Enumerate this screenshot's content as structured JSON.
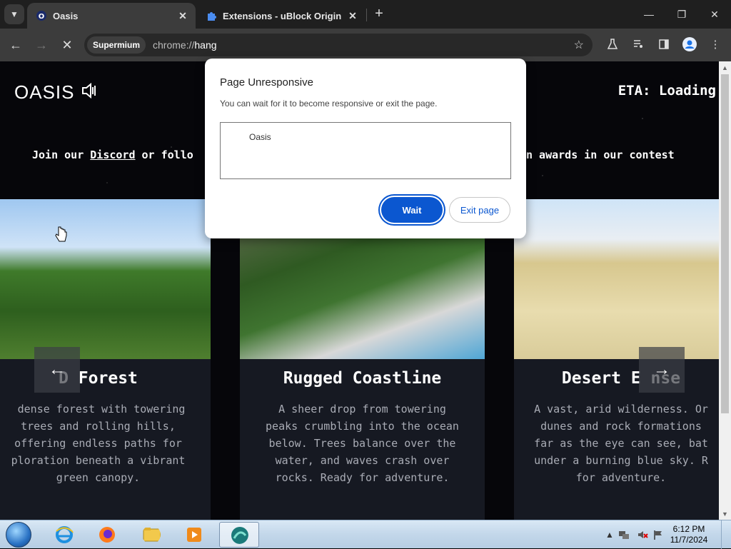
{
  "browser": {
    "tabs": [
      {
        "title": "Oasis",
        "favicon": "O"
      },
      {
        "title": "Extensions - uBlock Origin"
      }
    ],
    "chip": "Supermium",
    "url_scheme": "chrome://",
    "url_host": "hang"
  },
  "page": {
    "logo": "OASIS",
    "eta": "ETA: Loading",
    "promo_start": "Join our ",
    "promo_link": "Discord",
    "promo_mid": " or follo",
    "promo_end": "n awards in our contest",
    "cards": [
      {
        "title": "D   Forest",
        "desc": " dense forest with towering\ntrees and rolling hills,\noffering endless paths for\nploration beneath a vibrant\ngreen canopy."
      },
      {
        "title": "Rugged Coastline",
        "desc": "A sheer drop from towering\npeaks crumbling into the ocean\nbelow. Trees balance over the\nwater, and waves crash over\nrocks. Ready for adventure."
      },
      {
        "title": "Desert E    nse",
        "desc": "A vast, arid wilderness. Or\ndunes and rock formations\nfar as the eye can see, bat\nunder a burning blue sky. R\nfor adventure."
      }
    ]
  },
  "dialog": {
    "title": "Page Unresponsive",
    "message": "You can wait for it to become responsive or exit the page.",
    "items": [
      "Oasis"
    ],
    "wait_label": "Wait",
    "exit_label": "Exit page"
  },
  "taskbar": {
    "time": "6:12 PM",
    "date": "11/7/2024"
  }
}
